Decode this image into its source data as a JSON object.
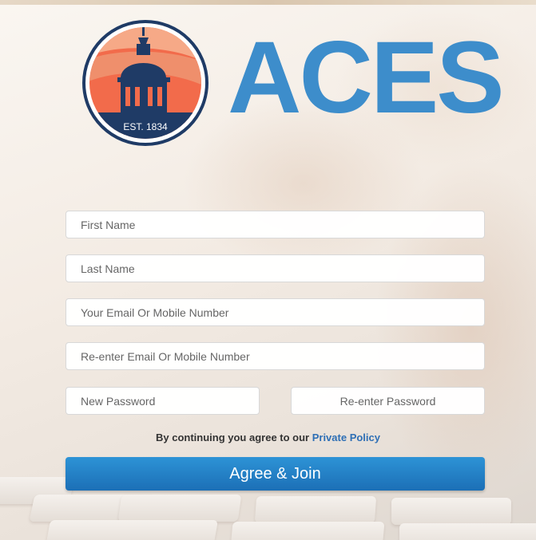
{
  "logo": {
    "brand": "ACES",
    "est_text": "EST. 1834",
    "brand_color": "#3d8dcb",
    "emblem_colors": [
      "#f26b4b",
      "#ef8f6c",
      "#1f3b66"
    ]
  },
  "form": {
    "first_name_placeholder": "First Name",
    "last_name_placeholder": "Last Name",
    "email_placeholder": "Your Email Or Mobile Number",
    "reenter_email_placeholder": "Re-enter Email Or Mobile Number",
    "new_password_placeholder": "New Password",
    "reenter_password_placeholder": "Re-enter Password"
  },
  "consent": {
    "prefix": "By continuing you agree to our ",
    "link_label": "Private Policy",
    "link_color": "#2e6fb5"
  },
  "submit": {
    "label": "Agree & Join",
    "color": "#2483c8"
  }
}
